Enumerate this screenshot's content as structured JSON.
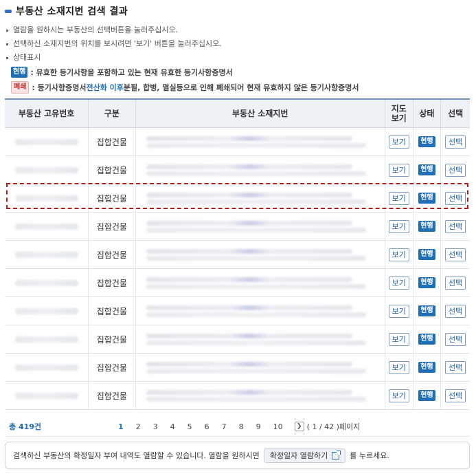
{
  "title": "부동산 소재지번 검색 결과",
  "notes": [
    "열람을 원하시는 부동산의 선택버튼을 눌러주십시오.",
    "선택하신 소재지번의 위치를 보시려면 '보기' 버튼을 눌러주십시오.",
    "상태표시"
  ],
  "legend": {
    "current_badge": "현행",
    "current_text": ": 유효한 등기사항을 포함하고 있는 현재 유효한 등기사항증명서",
    "closed_badge": "폐쇄",
    "closed_text_1": ": 등기사항증명서 ",
    "closed_text_hl": "전산화 이후",
    "closed_text_2": " 분필, 합병, 멸실등으로 인해 폐쇄되어 현재 유효하지 않은 등기사항증명서"
  },
  "table": {
    "headers": {
      "id": "부동산 고유번호",
      "type": "구분",
      "address": "부동산 소재지번",
      "map": "지도\n보기",
      "status": "상태",
      "select": "선택"
    },
    "rows": [
      {
        "type": "집합건물",
        "view": "보기",
        "status": "현행",
        "select": "선택"
      },
      {
        "type": "집합건물",
        "view": "보기",
        "status": "현행",
        "select": "선택"
      },
      {
        "type": "집합건물",
        "view": "보기",
        "status": "현행",
        "select": "선택"
      },
      {
        "type": "집합건물",
        "view": "보기",
        "status": "현행",
        "select": "선택"
      },
      {
        "type": "집합건물",
        "view": "보기",
        "status": "현행",
        "select": "선택"
      },
      {
        "type": "집합건물",
        "view": "보기",
        "status": "현행",
        "select": "선택"
      },
      {
        "type": "집합건물",
        "view": "보기",
        "status": "현행",
        "select": "선택"
      },
      {
        "type": "집합건물",
        "view": "보기",
        "status": "현행",
        "select": "선택"
      },
      {
        "type": "집합건물",
        "view": "보기",
        "status": "현행",
        "select": "선택"
      },
      {
        "type": "집합건물",
        "view": "보기",
        "status": "현행",
        "select": "선택"
      }
    ]
  },
  "pagination": {
    "total_prefix": "총 ",
    "total_count": "419",
    "total_suffix": "건",
    "pages": [
      "1",
      "2",
      "3",
      "4",
      "5",
      "6",
      "7",
      "8",
      "9",
      "10"
    ],
    "current_page": "1",
    "page_info": "( 1 / 42 )페이지"
  },
  "info": {
    "text_before": "검색하신 부동산의 확정일자 부여 내역도 열람할 수 있습니다. 열람을 원하시면",
    "button": "확정일자 열람하기",
    "text_after": "를 누르세요."
  },
  "colors": {
    "accent": "#1f6fb8",
    "highlight_border": "#b01c1c"
  }
}
